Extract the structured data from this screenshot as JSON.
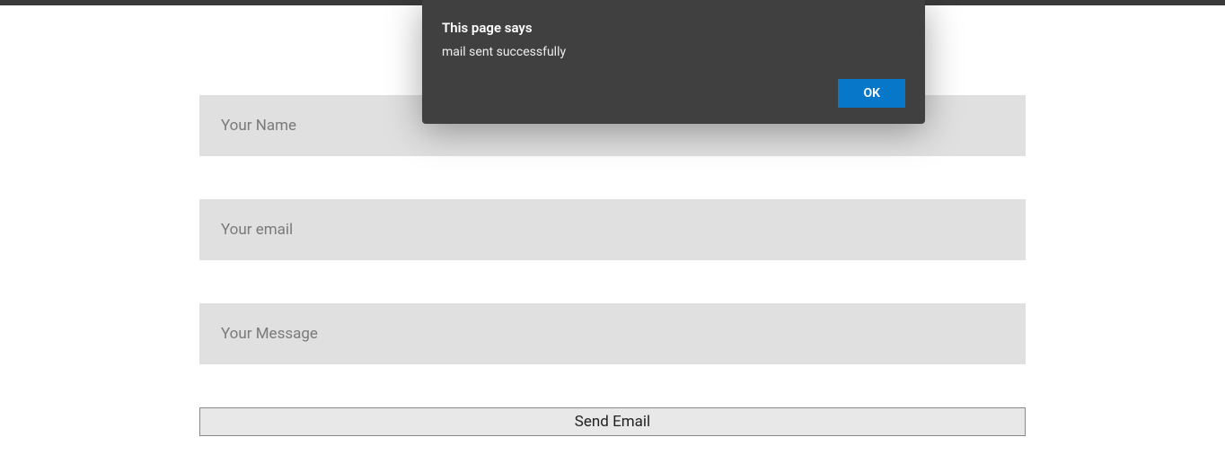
{
  "dialog": {
    "title": "This page says",
    "message": "mail sent successfully",
    "ok_label": "OK"
  },
  "form": {
    "name_placeholder": "Your Name",
    "name_value": "",
    "email_placeholder": "Your email",
    "email_value": "",
    "message_placeholder": "Your Message",
    "message_value": "",
    "submit_label": "Send Email"
  }
}
